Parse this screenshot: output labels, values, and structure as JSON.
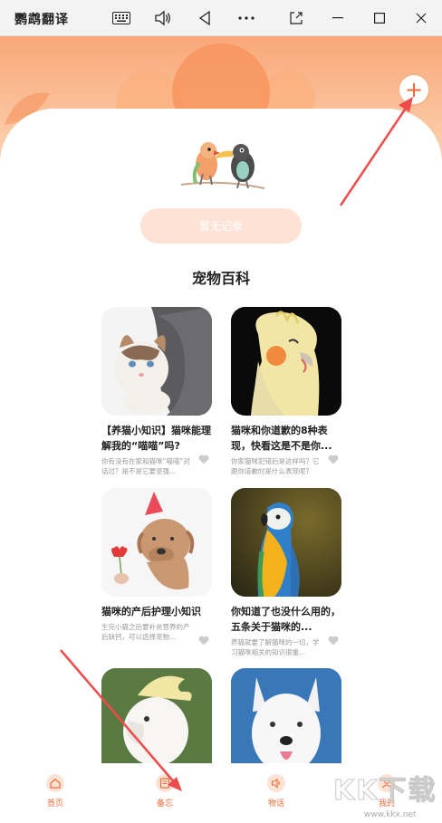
{
  "window": {
    "title": "鹦鹉翻译"
  },
  "header": {
    "add_symbol": "+"
  },
  "empty_state": {
    "text": "暂无记录"
  },
  "section": {
    "title": "宠物百科"
  },
  "cards": [
    {
      "title": "【养猫小知识】猫咪能理解我的“喵喵”吗?",
      "desc": "你有没有在家和猫咪“喵喵”对话过？是不是它要坚强...",
      "image": "cat-image"
    },
    {
      "title": "猫咪和你道歉的8种表现，快看这是不是你...",
      "desc": "你家猫咪犯错后是这样吗？它跟你道歉时是什么表现呢?",
      "image": "cockatiel-image"
    },
    {
      "title": "猫咪的产后护理小知识",
      "desc": "生完小猫之后要补充营养的产后缺钙，可以选择宠物...",
      "image": "dog-party-hat-image"
    },
    {
      "title": "你知道了也没什么用的，五条关于猫咪的...",
      "desc": "养猫就要了解猫咪的一切，学习猫咪相关的知识很重...",
      "image": "macaw-image"
    },
    {
      "title": "",
      "desc": "",
      "image": "cockatoo-image"
    },
    {
      "title": "",
      "desc": "",
      "image": "white-dog-image"
    }
  ],
  "nav": [
    {
      "label": "首页",
      "icon": "home-icon"
    },
    {
      "label": "备忘",
      "icon": "memo-icon"
    },
    {
      "label": "物话",
      "icon": "speaker-icon"
    },
    {
      "label": "我的",
      "icon": "profile-icon"
    }
  ],
  "watermark": {
    "big": "KK下载",
    "small": "www.kkx.net"
  },
  "colors": {
    "accent": "#f26b3a",
    "arrow": "#ee4b4b",
    "hero": "#f8a879"
  }
}
